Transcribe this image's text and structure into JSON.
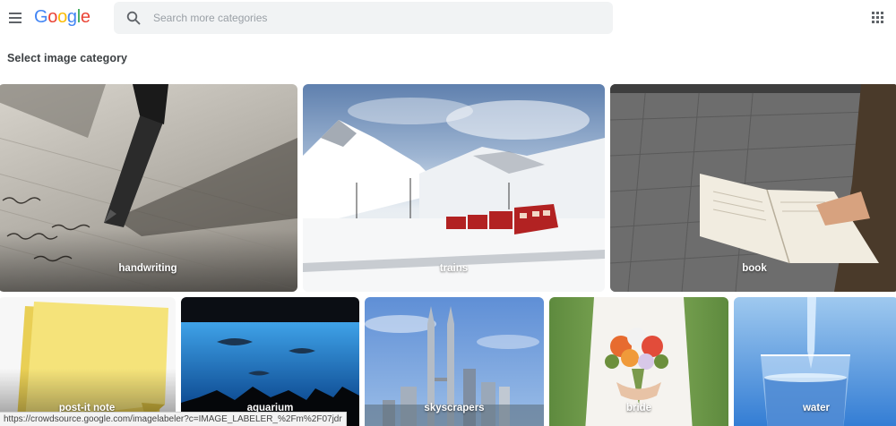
{
  "header": {
    "logo_letters": [
      "G",
      "o",
      "o",
      "g",
      "l",
      "e"
    ],
    "search_placeholder": "Search more categories",
    "menu_icon": "hamburger-menu-icon",
    "apps_icon": "apps-grid-icon",
    "search_icon": "search-icon"
  },
  "page": {
    "heading": "Select image category"
  },
  "categories": [
    {
      "label": "handwriting"
    },
    {
      "label": "trains"
    },
    {
      "label": "book"
    },
    {
      "label": "post-it note"
    },
    {
      "label": "aquarium"
    },
    {
      "label": "skyscrapers"
    },
    {
      "label": "bride"
    },
    {
      "label": "water"
    }
  ],
  "status_bar": {
    "url": "https://crowdsource.google.com/imagelabeler?c=IMAGE_LABELER_%2Fm%2F07jdr"
  }
}
